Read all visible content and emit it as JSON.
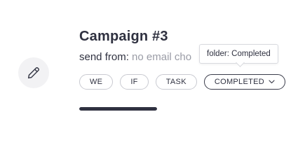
{
  "campaign": {
    "title": "Campaign #3",
    "sender_label": "send from:",
    "sender_value": "no email cho"
  },
  "tags": [
    {
      "label": "WE",
      "selected": false
    },
    {
      "label": "IF",
      "selected": false
    },
    {
      "label": "TASK",
      "selected": false
    },
    {
      "label": "COMPLETED",
      "selected": true
    }
  ],
  "tooltip": {
    "text": "folder: Completed"
  },
  "progress": {
    "fraction": 1.0
  },
  "icons": {
    "edit": "pencil-icon",
    "dropdown": "chevron-down-icon"
  },
  "colors": {
    "text": "#2f3140",
    "muted": "#9a9ca6",
    "edit_bg": "#f2f2f4"
  }
}
